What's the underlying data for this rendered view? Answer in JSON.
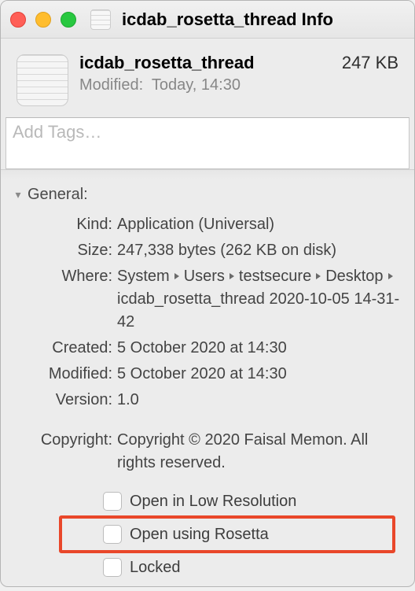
{
  "window": {
    "title": "icdab_rosetta_thread Info"
  },
  "summary": {
    "name": "icdab_rosetta_thread",
    "size": "247 KB",
    "modified_label": "Modified:",
    "modified_value": "Today, 14:30"
  },
  "tags": {
    "placeholder": "Add Tags…"
  },
  "section": {
    "title": "General:"
  },
  "general": {
    "labels": {
      "kind": "Kind:",
      "size": "Size:",
      "where": "Where:",
      "created": "Created:",
      "modified": "Modified:",
      "version": "Version:",
      "copyright": "Copyright:"
    },
    "kind": "Application (Universal)",
    "size": "247,338 bytes (262 KB on disk)",
    "where_parts": [
      "System",
      "Users",
      "testsecure",
      "Desktop",
      "icdab_rosetta_thread 2020-10-05 14-31-42"
    ],
    "created": "5 October 2020 at 14:30",
    "modified": "5 October 2020 at 14:30",
    "version": "1.0",
    "copyright": "Copyright © 2020 Faisal Memon. All rights reserved."
  },
  "checks": {
    "low_res": "Open in Low Resolution",
    "rosetta": "Open using Rosetta",
    "locked": "Locked"
  }
}
